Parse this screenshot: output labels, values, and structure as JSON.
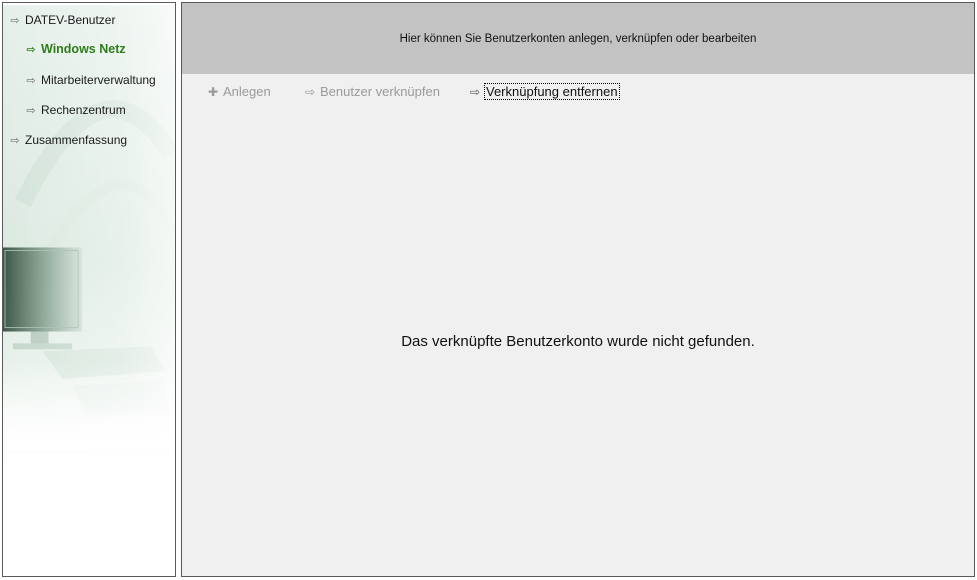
{
  "sidebar": {
    "items": [
      {
        "label": "DATEV-Benutzer",
        "icon": "arrow-right-icon",
        "active": false,
        "level": 0
      },
      {
        "label": "Windows Netz",
        "icon": "arrow-right-icon",
        "active": true,
        "level": 1
      },
      {
        "label": "Mitarbeiterverwaltung",
        "icon": "arrow-right-icon",
        "active": false,
        "level": 1
      },
      {
        "label": "Rechenzentrum",
        "icon": "arrow-right-icon",
        "active": false,
        "level": 1
      },
      {
        "label": "Zusammenfassung",
        "icon": "arrow-right-icon",
        "active": false,
        "level": 0
      }
    ]
  },
  "header": {
    "text": "Hier können Sie Benutzerkonten anlegen, verknüpfen oder bearbeiten"
  },
  "toolbar": {
    "create_label": "Anlegen",
    "link_label": "Benutzer verknüpfen",
    "unlink_label": "Verknüpfung entfernen"
  },
  "main": {
    "message": "Das verknüpfte Benutzerkonto wurde nicht gefunden."
  },
  "colors": {
    "active_nav": "#2e7d1a",
    "header_band": "#c3c3c3",
    "panel_bg": "#f0f0f0",
    "disabled_text": "#9a9a9a"
  }
}
